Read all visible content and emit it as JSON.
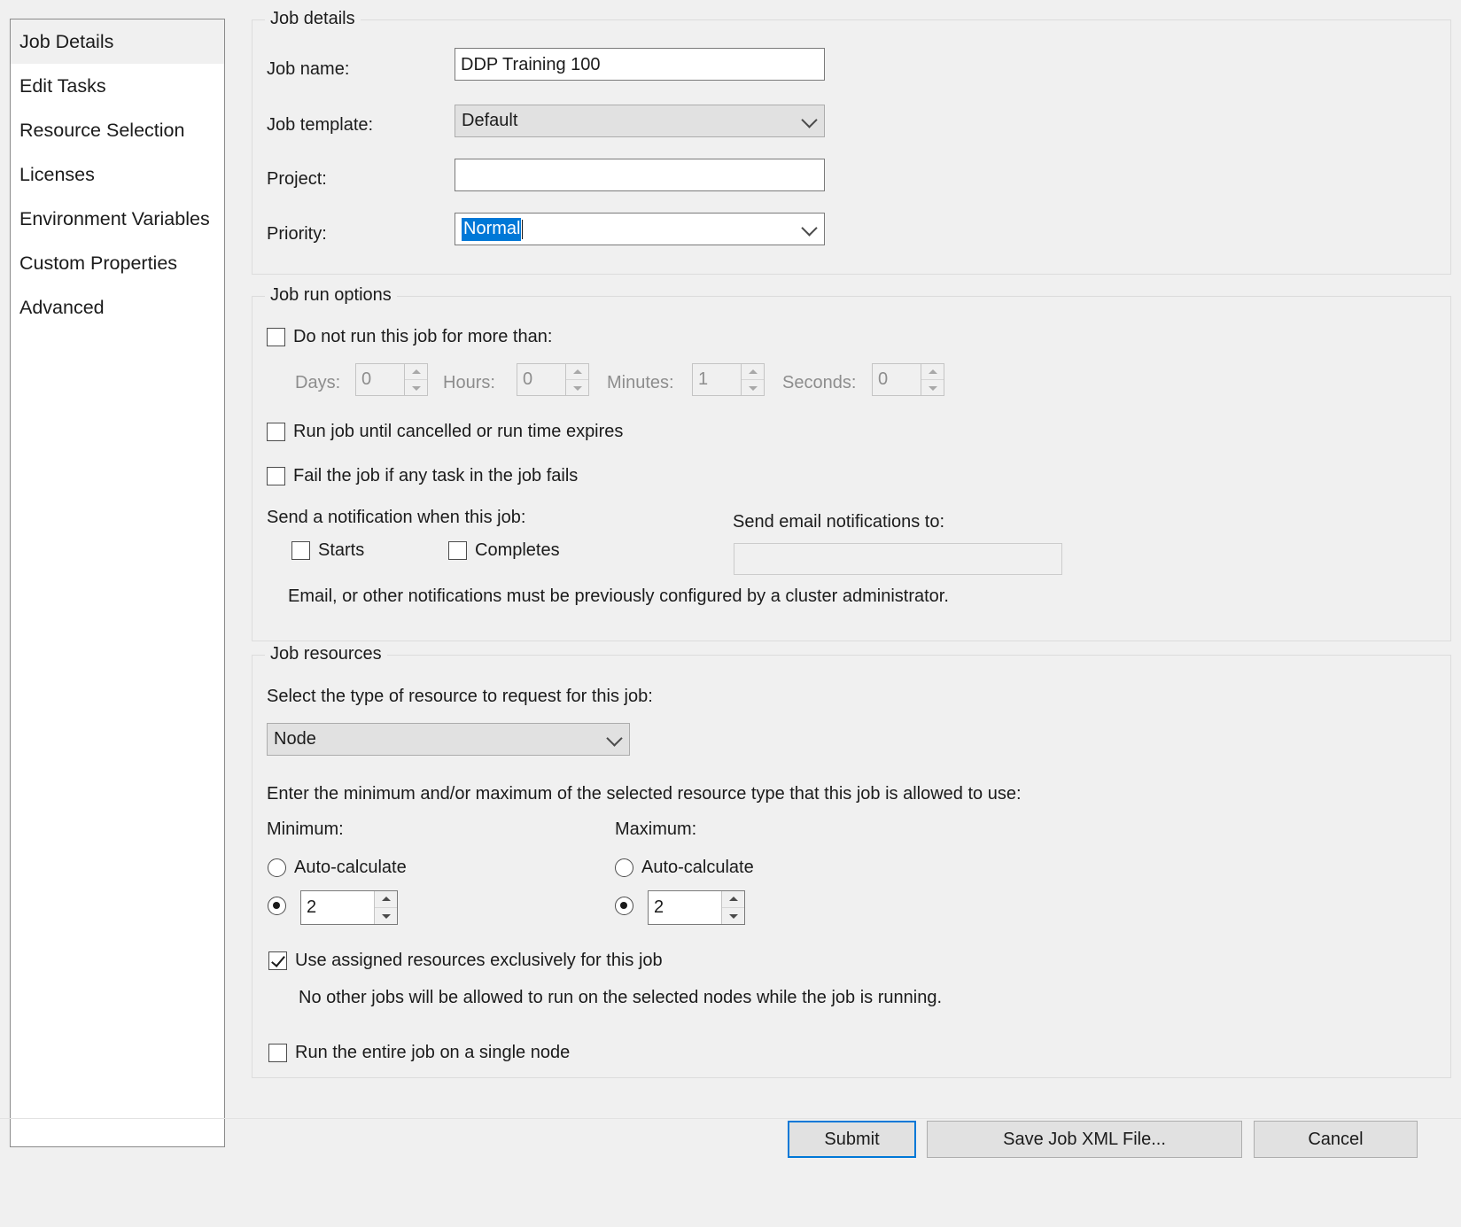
{
  "sidebar": {
    "items": [
      {
        "label": "Job Details",
        "selected": true
      },
      {
        "label": "Edit Tasks",
        "selected": false
      },
      {
        "label": "Resource Selection",
        "selected": false
      },
      {
        "label": "Licenses",
        "selected": false
      },
      {
        "label": "Environment Variables",
        "selected": false
      },
      {
        "label": "Custom Properties",
        "selected": false
      },
      {
        "label": "Advanced",
        "selected": false
      }
    ]
  },
  "job_details": {
    "title": "Job details",
    "job_name_label": "Job name:",
    "job_name_value": "DDP Training 100",
    "job_template_label": "Job template:",
    "job_template_value": "Default",
    "project_label": "Project:",
    "project_value": "",
    "priority_label": "Priority:",
    "priority_value": "Normal"
  },
  "run_options": {
    "title": "Job run options",
    "max_runtime_label": "Do not run this job for more than:",
    "max_runtime_checked": false,
    "days_label": "Days:",
    "days_value": "0",
    "hours_label": "Hours:",
    "hours_value": "0",
    "minutes_label": "Minutes:",
    "minutes_value": "1",
    "seconds_label": "Seconds:",
    "seconds_value": "0",
    "run_until_cancelled_label": "Run job until cancelled or run time expires",
    "run_until_cancelled_checked": false,
    "fail_job_label": "Fail the job if any task in the job fails",
    "fail_job_checked": false,
    "notify_heading": "Send a notification when this job:",
    "notify_starts_label": "Starts",
    "notify_starts_checked": false,
    "notify_completes_label": "Completes",
    "notify_completes_checked": false,
    "email_heading": "Send email notifications to:",
    "email_value": "",
    "email_note": "Email, or other notifications must be previously configured by a cluster administrator."
  },
  "job_resources": {
    "title": "Job resources",
    "resource_type_heading": "Select the type of resource to request for this job:",
    "resource_type_value": "Node",
    "minmax_heading": "Enter the minimum and/or maximum of the selected resource type that this job is allowed to use:",
    "minimum_label": "Minimum:",
    "minimum_auto_label": "Auto-calculate",
    "minimum_auto_selected": false,
    "minimum_value": "2",
    "minimum_value_selected": true,
    "maximum_label": "Maximum:",
    "maximum_auto_label": "Auto-calculate",
    "maximum_auto_selected": false,
    "maximum_value": "2",
    "maximum_value_selected": true,
    "exclusive_label": "Use assigned resources exclusively for this job",
    "exclusive_checked": true,
    "exclusive_note": "No other jobs will be allowed to run on the selected nodes while the job is running.",
    "single_node_label": "Run the entire job on a single node",
    "single_node_checked": false
  },
  "footer": {
    "submit_label": "Submit",
    "save_xml_label": "Save Job XML File...",
    "cancel_label": "Cancel"
  },
  "colors": {
    "accent": "#0078d7",
    "window_bg": "#f0f0f0",
    "control_bg": "#e1e1e1",
    "text": "#1b1b1b",
    "disabled_text": "#8d8d8d"
  }
}
